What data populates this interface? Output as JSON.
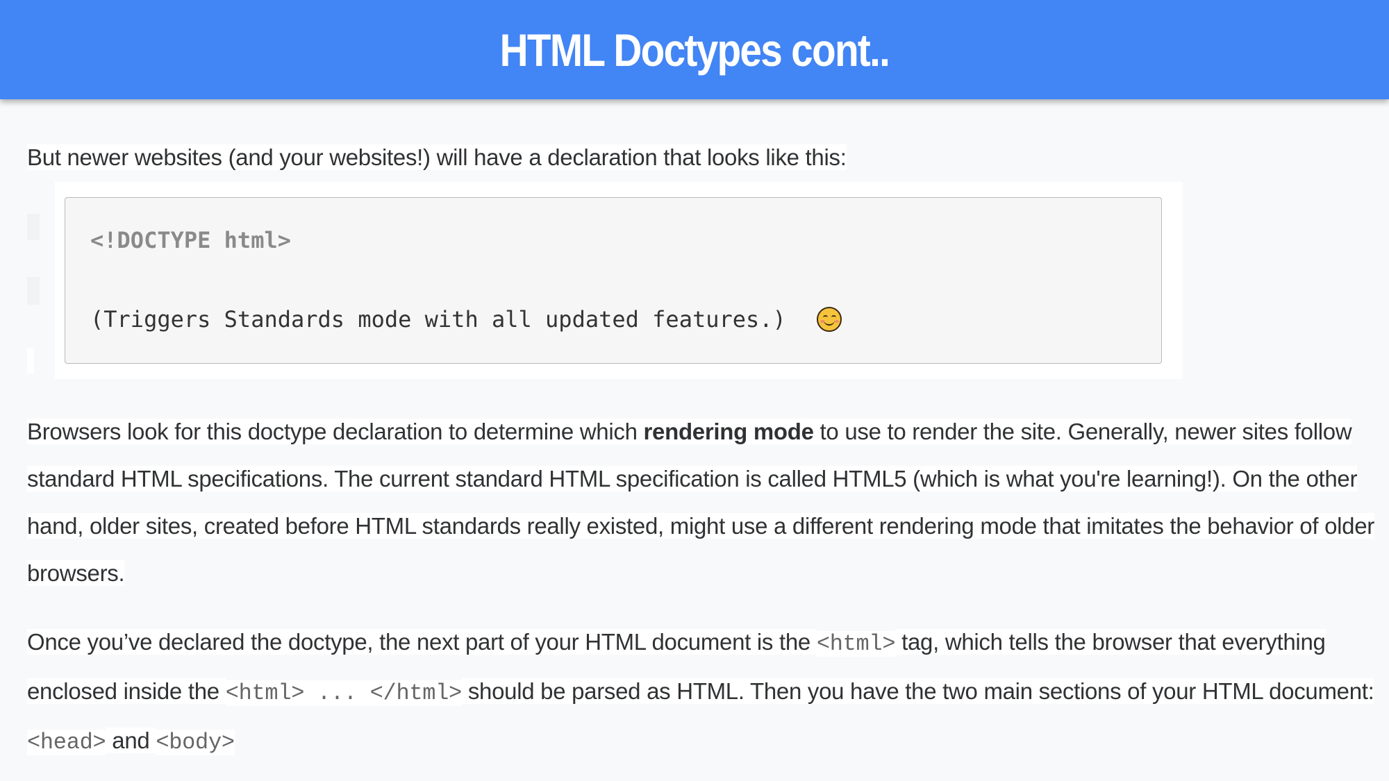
{
  "slide": {
    "title": "HTML Doctypes cont..",
    "colors": {
      "header_background": "#4285f4",
      "title_text": "#ffffff",
      "page_background": "#f8f9fa"
    }
  },
  "intro": {
    "text": "But newer websites (and your websites!) will have a declaration that looks like this:"
  },
  "code_block": {
    "line1": "<!DOCTYPE html>",
    "line2": "(Triggers Standards mode with all updated features.)",
    "emoji_icon": "smiling-face-icon"
  },
  "paragraph1": {
    "part1": "Browsers look for this doctype declaration to determine which ",
    "bold": "rendering mode",
    "part2": " to use to render the site. Generally, newer sites follow standard HTML specifications. The current standard HTML specification is called HTML5 (which is what you're learning!). On the other hand, older sites, created before HTML standards really existed, might use a different rendering mode that imitates the behavior of older browsers."
  },
  "paragraph2": {
    "part1": "Once you’ve declared the doctype, the next part of your HTML document is the ",
    "code1": "<html>",
    "part2": " tag, which tells the browser that everything enclosed inside the ",
    "code2": "<html> ... </html>",
    "part3": " should be parsed as HTML. Then you have the two main sections of your HTML document: ",
    "code3": "<head>",
    "part4": " and ",
    "code4": "<body>"
  }
}
